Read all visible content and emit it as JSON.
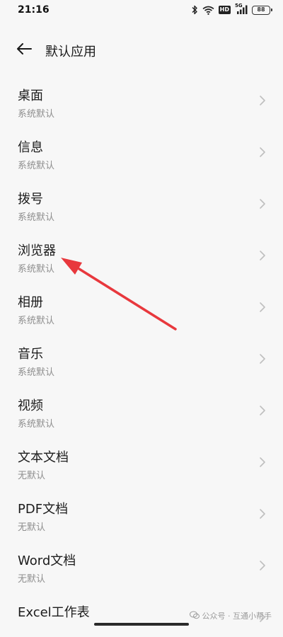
{
  "status_bar": {
    "time": "21:16",
    "hd_label": "HD",
    "network_label": "5G",
    "battery": "88"
  },
  "header": {
    "title": "默认应用"
  },
  "items": [
    {
      "title": "桌面",
      "subtitle": "系统默认"
    },
    {
      "title": "信息",
      "subtitle": "系统默认"
    },
    {
      "title": "拨号",
      "subtitle": "系统默认"
    },
    {
      "title": "浏览器",
      "subtitle": "系统默认"
    },
    {
      "title": "相册",
      "subtitle": "系统默认"
    },
    {
      "title": "音乐",
      "subtitle": "系统默认"
    },
    {
      "title": "视频",
      "subtitle": "系统默认"
    },
    {
      "title": "文本文档",
      "subtitle": "无默认"
    },
    {
      "title": "PDF文档",
      "subtitle": "无默认"
    },
    {
      "title": "Word文档",
      "subtitle": "无默认"
    },
    {
      "title": "Excel工作表",
      "subtitle": ""
    }
  ],
  "watermark": "公众号 · 互通小帮手",
  "colors": {
    "annotation_arrow": "#e8383d",
    "background": "#f7f7f7"
  }
}
